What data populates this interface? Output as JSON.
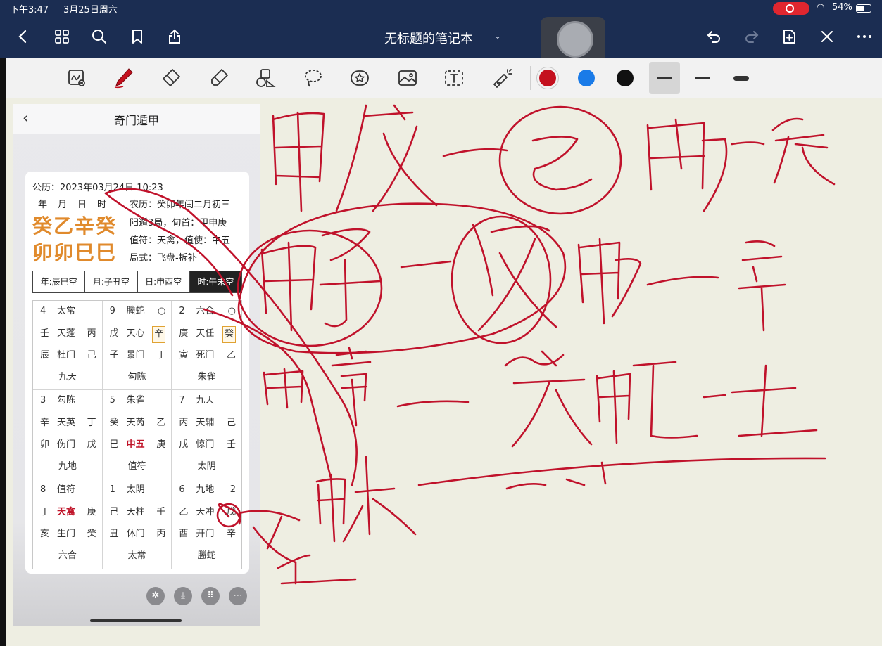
{
  "status_bar": {
    "time": "下午3:47",
    "date": "3月25日周六",
    "battery": "54%"
  },
  "nav": {
    "title": "无标题的笔记本",
    "icons": [
      "back-icon",
      "grid-icon",
      "search-icon",
      "bookmark-icon",
      "share-icon",
      "undo-icon",
      "redo-icon",
      "add-page-icon",
      "close-icon",
      "more-icon"
    ]
  },
  "toolbar": {
    "tools": [
      "image-insert-icon",
      "pen-icon",
      "eraser-icon",
      "highlighter-icon",
      "shapes-icon",
      "lasso-icon",
      "sticker-icon",
      "image-icon",
      "text-icon",
      "laser-pointer-icon"
    ],
    "colors": [
      "#c4101e",
      "#1a7be8",
      "#111111"
    ],
    "selected_color": "#c4101e"
  },
  "app": {
    "title": "奇门遁甲",
    "solar": "公历：2023年03月24日 10:23",
    "pillar_labels": "年　月　日　时",
    "lunar": "农历：癸卯年闰二月初三",
    "stems": "癸乙辛癸",
    "branches": "卯卯巳巳",
    "ju": "阳遁3局，旬首：甲申庚",
    "zhifu": "值符：天禽，值使：中五",
    "style": "局式：飞盘-拆补",
    "voids": [
      "年:辰巳空",
      "月:子丑空",
      "日:申酉空",
      "时:午未空"
    ],
    "palaces": [
      {
        "num": "4",
        "god": "太常",
        "ring": "",
        "star_stem": "壬",
        "star": "天蓬",
        "star_hidden": "丙",
        "door_stem": "辰",
        "door": "杜门",
        "door_hidden": "己",
        "bottom": "九天"
      },
      {
        "num": "9",
        "god": "螣蛇",
        "ring": "○",
        "star_stem": "戊",
        "star": "天心",
        "star_hidden": "辛",
        "door_stem": "子",
        "door": "景门",
        "door_hidden": "丁",
        "bottom": "勾陈"
      },
      {
        "num": "2",
        "god": "六合",
        "ring": "○",
        "star_stem": "庚",
        "star": "天任",
        "star_hidden": "癸",
        "door_stem": "寅",
        "door": "死门",
        "door_hidden": "乙",
        "bottom": "朱雀"
      },
      {
        "num": "3",
        "god": "勾陈",
        "ring": "",
        "star_stem": "辛",
        "star": "天英",
        "star_hidden": "丁",
        "door_stem": "卯",
        "door": "伤门",
        "door_hidden": "戊",
        "bottom": "九地"
      },
      {
        "num": "5",
        "god": "朱雀",
        "ring": "",
        "star_stem": "癸",
        "star": "天芮",
        "star_hidden": "乙",
        "door_stem": "巳",
        "door": "中五",
        "door_hidden": "庚",
        "bottom": "值符"
      },
      {
        "num": "7",
        "god": "九天",
        "ring": "",
        "star_stem": "丙",
        "star": "天辅",
        "star_hidden": "己",
        "door_stem": "戌",
        "door": "惊门",
        "door_hidden": "壬",
        "bottom": "太阴"
      },
      {
        "num": "8",
        "god": "值符",
        "ring": "",
        "star_stem": "丁",
        "star": "天禽",
        "star_hidden": "庚",
        "door_stem": "亥",
        "door": "生门",
        "door_hidden": "癸",
        "bottom": "六合"
      },
      {
        "num": "1",
        "god": "太阴",
        "ring": "",
        "star_stem": "己",
        "star": "天柱",
        "star_hidden": "壬",
        "door_stem": "丑",
        "door": "休门",
        "door_hidden": "丙",
        "bottom": "太常"
      },
      {
        "num": "6",
        "god": "九地",
        "ring": "2",
        "star_stem": "乙",
        "star": "天冲",
        "star_hidden": "戊",
        "door_stem": "酉",
        "door": "开门",
        "door_hidden": "辛",
        "bottom": "螣蛇"
      }
    ],
    "bottom_icons": [
      "compass-icon",
      "download-icon",
      "apps-icon",
      "more-icon"
    ]
  }
}
